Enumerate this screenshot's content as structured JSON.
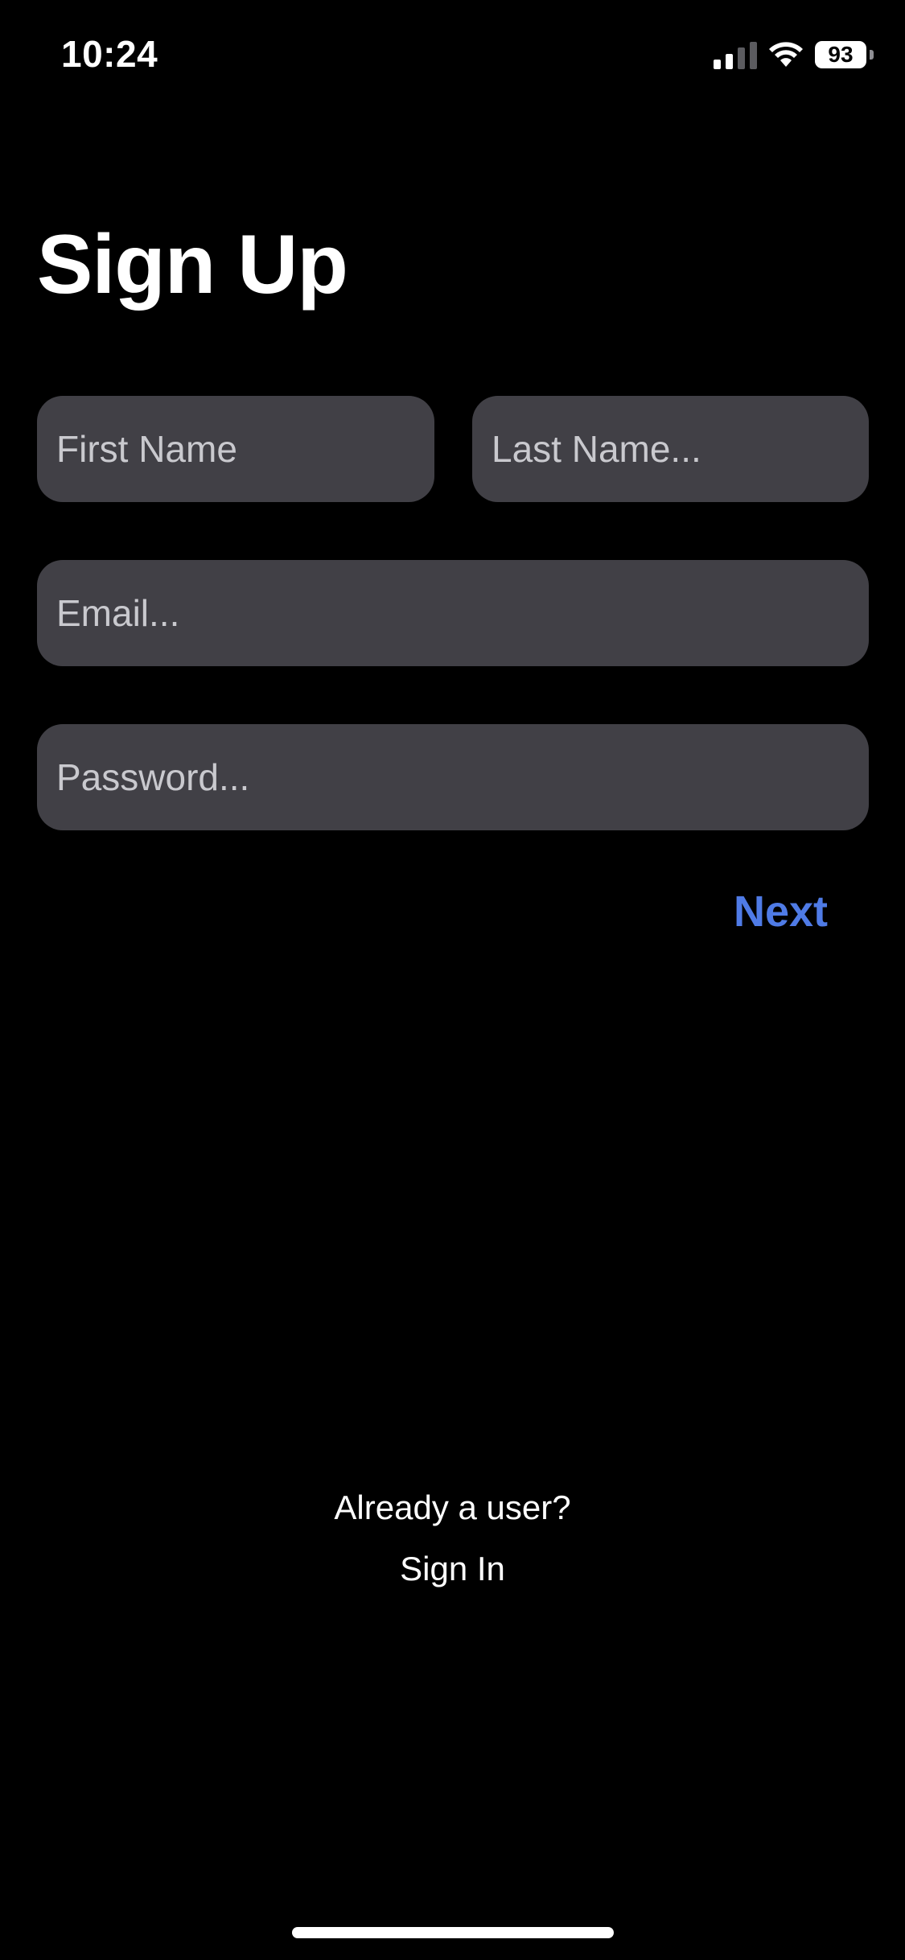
{
  "status_bar": {
    "time": "10:24",
    "battery_level": "93",
    "signal_icon": "cellular-signal-icon",
    "wifi_icon": "wifi-icon"
  },
  "title": "Sign Up",
  "form": {
    "first_name": {
      "value": "",
      "placeholder": "First Name"
    },
    "last_name": {
      "value": "",
      "placeholder": "Last Name..."
    },
    "email": {
      "value": "",
      "placeholder": "Email..."
    },
    "password": {
      "value": "",
      "placeholder": "Password..."
    }
  },
  "next_label": "Next",
  "footer": {
    "prompt": "Already a user?",
    "sign_in_label": "Sign In"
  },
  "colors": {
    "background": "#000000",
    "field_background": "#414046",
    "accent": "#4f7be6"
  }
}
